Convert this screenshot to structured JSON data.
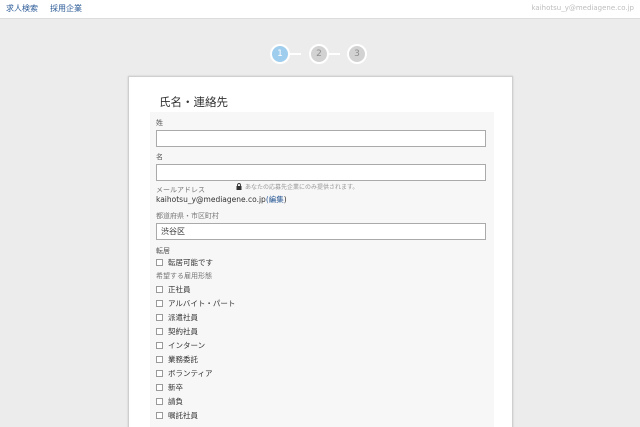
{
  "header": {
    "nav": [
      "求人検索",
      "採用企業"
    ],
    "user_email": "kaihotsu_y@mediagene.co.jp"
  },
  "steps": [
    "1",
    "2",
    "3"
  ],
  "card": {
    "title": "氏名・連絡先",
    "last_name": {
      "label": "姓",
      "value": ""
    },
    "first_name": {
      "label": "名",
      "value": ""
    },
    "email": {
      "label": "メールアドレス",
      "note": "あなたの応募先企業にのみ提供されます。",
      "value": "kaihotsu_y@mediagene.co.jp",
      "edit_open": "(",
      "edit_label": "編集",
      "edit_close": ")"
    },
    "location": {
      "label": "都道府県・市区町村",
      "value": "渋谷区"
    },
    "relocation": {
      "label": "転居",
      "option": "転居可能です"
    },
    "employment": {
      "label": "希望する雇用形態",
      "options": [
        "正社員",
        "アルバイト・パート",
        "派遣社員",
        "契約社員",
        "インターン",
        "業務委託",
        "ボランティア",
        "新卒",
        "請負",
        "嘱託社員"
      ]
    }
  }
}
